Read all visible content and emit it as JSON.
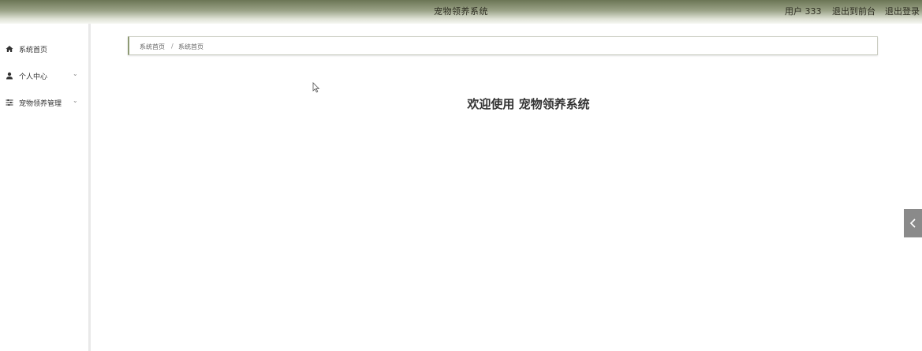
{
  "header": {
    "app_title": "宠物领养系统",
    "user_label": "用户 333",
    "front_link": "退出到前台",
    "logout_link": "退出登录"
  },
  "sidebar": {
    "items": [
      {
        "label": "系统首页",
        "icon": "home-icon"
      },
      {
        "label": "个人中心",
        "icon": "user-icon"
      },
      {
        "label": "宠物领养管理",
        "icon": "sliders-icon"
      }
    ]
  },
  "breadcrumb": {
    "items": [
      "系统首页",
      "系统首页"
    ],
    "separator": "/"
  },
  "main": {
    "welcome": "欢迎使用 宠物领养系统"
  }
}
